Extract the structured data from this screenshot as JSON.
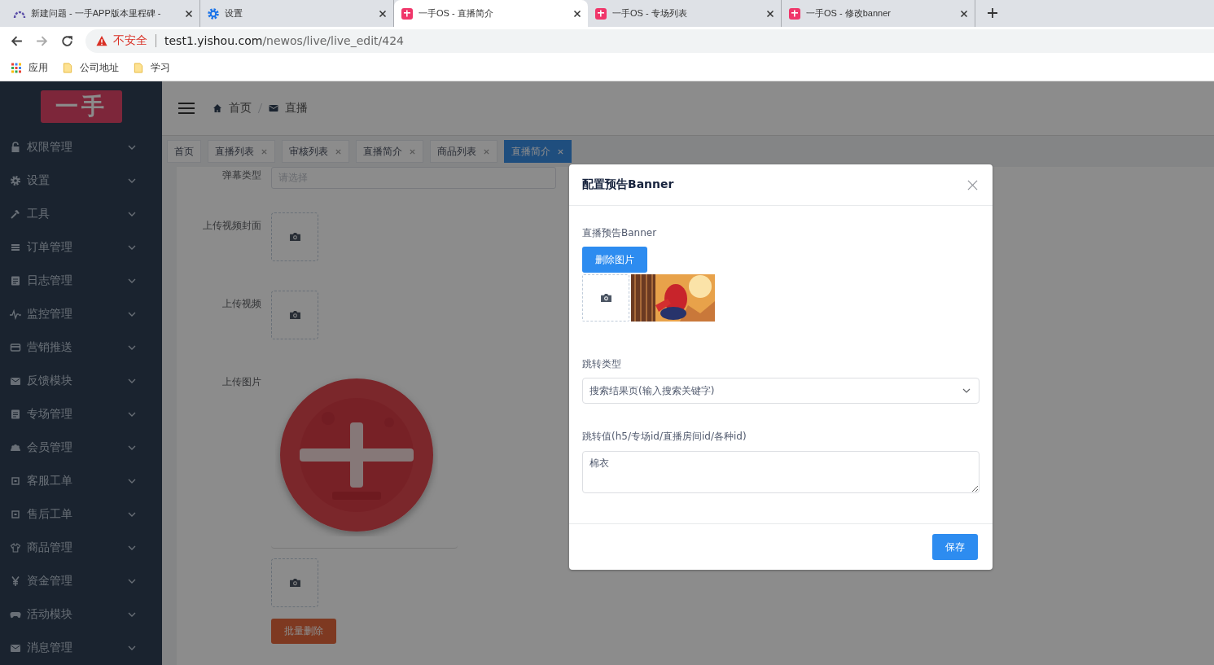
{
  "browser": {
    "tabs": [
      {
        "kind": "arc",
        "title": "新建问题 - 一手APP版本里程碑 -",
        "selected": false
      },
      {
        "kind": "gear",
        "title": "设置",
        "selected": false
      },
      {
        "kind": "app",
        "title": "一手OS - 直播简介",
        "selected": true
      },
      {
        "kind": "app",
        "title": "一手OS - 专场列表",
        "selected": false
      },
      {
        "kind": "app",
        "title": "一手OS - 修改banner",
        "selected": false
      }
    ],
    "security": "不安全",
    "url_host": "test1.yishou.com",
    "url_path": "/newos/live/live_edit/424",
    "bookmarks": [
      {
        "kind": "apps",
        "label": "应用"
      },
      {
        "kind": "folder",
        "label": "公司地址"
      },
      {
        "kind": "folder",
        "label": "学习"
      }
    ]
  },
  "sidebar": {
    "logo": "一手",
    "items": [
      {
        "kind": "lock",
        "label": "权限管理"
      },
      {
        "kind": "gear",
        "label": "设置"
      },
      {
        "kind": "hammer",
        "label": "工具"
      },
      {
        "kind": "list",
        "label": "订单管理"
      },
      {
        "kind": "document",
        "label": "日志管理"
      },
      {
        "kind": "pulse",
        "label": "监控管理"
      },
      {
        "kind": "card",
        "label": "营销推送"
      },
      {
        "kind": "mail",
        "label": "反馈模块"
      },
      {
        "kind": "document",
        "label": "专场管理"
      },
      {
        "kind": "people",
        "label": "会员管理"
      },
      {
        "kind": "box",
        "label": "客服工单"
      },
      {
        "kind": "box",
        "label": "售后工单"
      },
      {
        "kind": "shirt",
        "label": "商品管理"
      },
      {
        "kind": "yen",
        "label": "资金管理"
      },
      {
        "kind": "gamepad",
        "label": "活动模块"
      },
      {
        "kind": "mail",
        "label": "消息管理"
      }
    ]
  },
  "breadcrumb": [
    {
      "kind": "home",
      "label": "首页"
    },
    {
      "kind": "mail",
      "label": "直播"
    }
  ],
  "page_tabs": [
    {
      "label": "首页",
      "closable": false,
      "selected": false
    },
    {
      "label": "直播列表",
      "closable": true,
      "selected": false
    },
    {
      "label": "审核列表",
      "closable": true,
      "selected": false
    },
    {
      "label": "直播简介",
      "closable": true,
      "selected": false
    },
    {
      "label": "商品列表",
      "closable": true,
      "selected": false
    },
    {
      "label": "直播简介",
      "closable": true,
      "selected": true
    }
  ],
  "form": {
    "fields": [
      {
        "kind": "select",
        "label": "弹幕类型",
        "placeholder": "请选择"
      },
      {
        "kind": "upload",
        "label": "上传视频封面"
      },
      {
        "kind": "upload",
        "label": "上传视频"
      },
      {
        "kind": "image_upload",
        "label": "上传图片"
      }
    ],
    "batch_delete": "批量删除"
  },
  "dialog": {
    "title": "配置预告Banner",
    "banner_label": "直播预告Banner",
    "delete_button": "删除图片",
    "jump_type_label": "跳转类型",
    "jump_type_value": "搜索结果页(输入搜索关键字)",
    "jump_value_label": "跳转值(h5/专场id/直播房间id/各种id)",
    "jump_value": "棉衣",
    "save_button": "保存"
  }
}
